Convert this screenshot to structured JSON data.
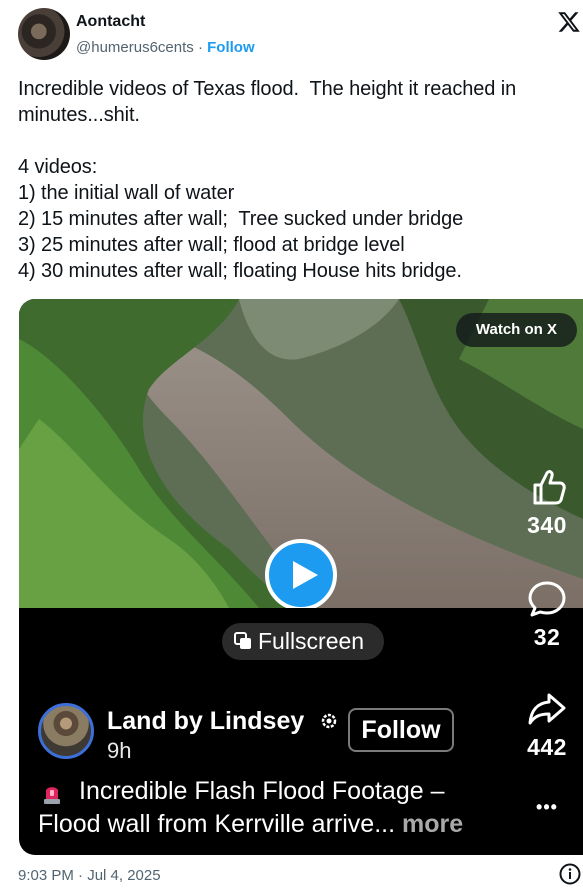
{
  "author": {
    "name": "Aontacht",
    "handle": "@humerus6cents",
    "separator": "·",
    "follow_label": "Follow"
  },
  "tweet": {
    "text": "Incredible videos of Texas flood.  The height it reached in minutes...shit.\n\n4 videos:\n1) the initial wall of water\n2) 15 minutes after wall;  Tree sucked under bridge\n3) 25 minutes after wall; flood at bridge level\n4) 30 minutes after wall; floating House hits bridge.",
    "timestamp": "9:03 PM · Jul 4, 2025"
  },
  "media": {
    "watch_on_x_label": "Watch on X",
    "fullscreen_label": "Fullscreen",
    "likes": "340",
    "comments": "32",
    "shares": "442",
    "more_dots": "•••",
    "creator": {
      "name": "Land by Lindsey",
      "time": "9h",
      "follow_label": "Follow"
    },
    "caption": {
      "line1": "Incredible Flash Flood Footage –",
      "line2": "Flood wall from Kerrville arrive...",
      "more": "more"
    }
  },
  "colors": {
    "accent": "#1d9bf0",
    "text": "#0f1419",
    "muted": "#536471"
  }
}
